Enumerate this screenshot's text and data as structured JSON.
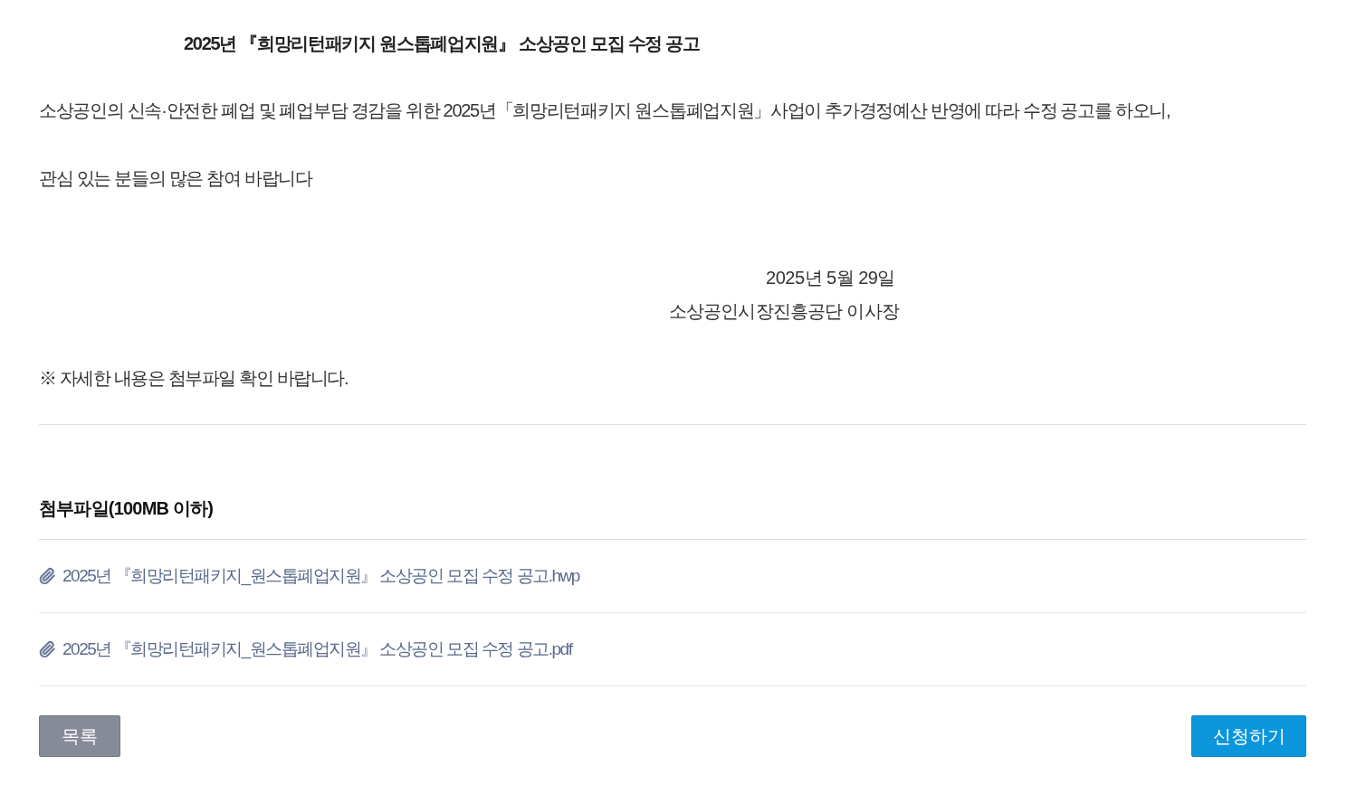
{
  "notice": {
    "title": "2025년 『희망리턴패키지 원스톱폐업지원』 소상공인 모집 수정 공고",
    "paragraphs": [
      "소상공인의 신속·안전한 폐업 및 폐업부담 경감을 위한 2025년「희망리턴패키지 원스톱폐업지원」사업이 추가경정예산 반영에 따라 수정 공고를 하오니,",
      "관심 있는 분들의 많은 참여 바랍니다"
    ],
    "date": "2025년 5월 29일",
    "issuer": "소상공인시장진흥공단 이사장",
    "note": "※ 자세한 내용은 첨부파일 확인 바랍니다."
  },
  "attachments": {
    "heading": "첨부파일(100MB 이하)",
    "files": [
      {
        "name": "2025년 『희망리턴패키지_원스톱폐업지원』 소상공인 모집 수정 공고.hwp"
      },
      {
        "name": "2025년 『희망리턴패키지_원스톱폐업지원』 소상공인 모집 수정 공고.pdf"
      }
    ]
  },
  "buttons": [
    {
      "label": "목록",
      "kind": "secondary"
    },
    {
      "label": "신청하기",
      "kind": "primary"
    }
  ]
}
